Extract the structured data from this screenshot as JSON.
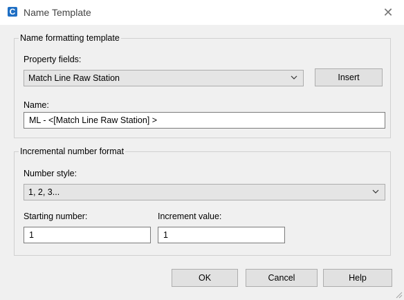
{
  "window": {
    "title": "Name Template",
    "app_icon_glyph": "C",
    "app_icon": "civil3d-logo-icon",
    "close_glyph": "✕"
  },
  "name_group": {
    "legend": "Name formatting template",
    "property_fields_label": "Property fields:",
    "property_fields_value": "Match Line Raw Station",
    "insert_label": "Insert",
    "name_label": "Name:",
    "name_value": "ML - <[Match Line Raw Station] >"
  },
  "number_group": {
    "legend": "Incremental number format",
    "number_style_label": "Number style:",
    "number_style_value": "1, 2, 3...",
    "starting_number_label": "Starting number:",
    "starting_number_value": "1",
    "increment_value_label": "Increment value:",
    "increment_value_value": "1"
  },
  "buttons": {
    "ok": "OK",
    "cancel": "Cancel",
    "help": "Help"
  },
  "colors": {
    "accent": "#1f6fc4",
    "dialog_bg": "#f0f0f0",
    "combo_bg": "#e5e5e5"
  }
}
